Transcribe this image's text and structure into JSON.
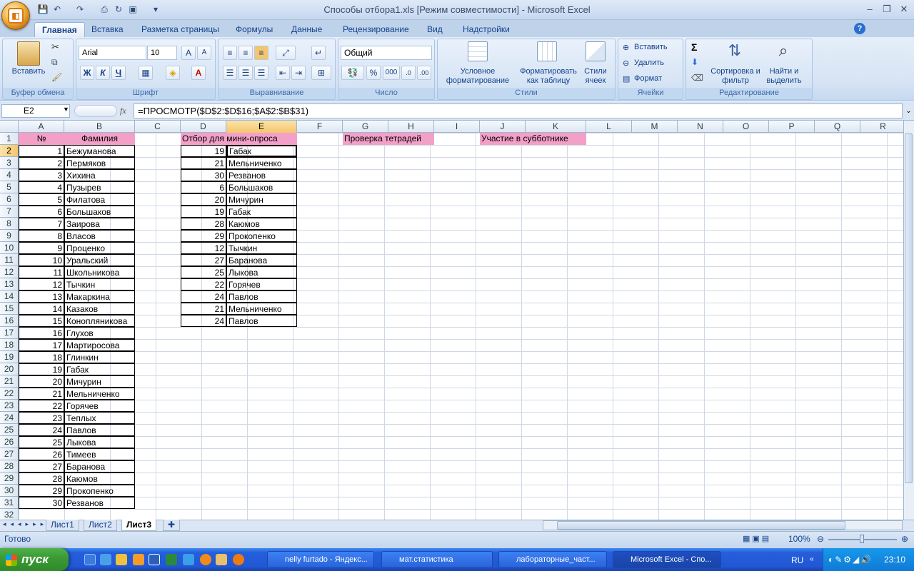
{
  "window": {
    "title": "Способы отбора1.xls  [Режим совместимости] - Microsoft Excel",
    "minimize": "–",
    "restore": "❐",
    "close": "✕"
  },
  "ribbon": {
    "tabs": [
      "Главная",
      "Вставка",
      "Разметка страницы",
      "Формулы",
      "Данные",
      "Рецензирование",
      "Вид",
      "Надстройки"
    ],
    "groups": {
      "clipboard": {
        "label": "Буфер обмена",
        "paste": "Вставить"
      },
      "font": {
        "label": "Шрифт",
        "font_name": "Arial",
        "font_size": "10",
        "bold": "Ж",
        "italic": "К",
        "underline": "Ч"
      },
      "alignment": {
        "label": "Выравнивание"
      },
      "number": {
        "label": "Число",
        "format": "Общий",
        "percent": "%",
        "thousands": "000"
      },
      "styles": {
        "label": "Стили",
        "conditional": "Условное форматирование",
        "as_table": "Форматировать как таблицу",
        "cell_styles": "Стили ячеек"
      },
      "cells": {
        "label": "Ячейки",
        "insert": "Вставить",
        "delete": "Удалить",
        "format": "Формат"
      },
      "editing": {
        "label": "Редактирование",
        "sort": "Сортировка и фильтр",
        "find": "Найти и выделить",
        "sigma": "Σ"
      }
    }
  },
  "formula_bar": {
    "name_box": "E2",
    "fx": "fx",
    "formula": "=ПРОСМОТР($D$2:$D$16;$A$2:$B$31)"
  },
  "grid": {
    "columns": [
      "A",
      "B",
      "C",
      "D",
      "E",
      "F",
      "G",
      "H",
      "I",
      "J",
      "K",
      "L",
      "M",
      "N",
      "O",
      "P",
      "Q",
      "R"
    ],
    "selected_column": "E",
    "selected_row": 2,
    "row_count": 32,
    "headers": {
      "A1": "№",
      "B1": "Фамилия",
      "D1": "Отбор для мини-опроса",
      "G1": "Проверка тетрадей",
      "J1": "Участие в субботнике"
    },
    "students": [
      [
        1,
        "Бежуманова"
      ],
      [
        2,
        "Пермяков"
      ],
      [
        3,
        "Хихина"
      ],
      [
        4,
        "Пузырев"
      ],
      [
        5,
        "Филатова"
      ],
      [
        6,
        "Большаков"
      ],
      [
        7,
        "Заирова"
      ],
      [
        8,
        "Власов"
      ],
      [
        9,
        "Проценко"
      ],
      [
        10,
        "Уральский"
      ],
      [
        11,
        "Школьникова"
      ],
      [
        12,
        "Тычкин"
      ],
      [
        13,
        "Макаркина"
      ],
      [
        14,
        "Казаков"
      ],
      [
        15,
        "Конопляникова"
      ],
      [
        16,
        "Глухов"
      ],
      [
        17,
        "Мартиросова"
      ],
      [
        18,
        "Глинкин"
      ],
      [
        19,
        "Габак"
      ],
      [
        20,
        "Мичурин"
      ],
      [
        21,
        "Мельниченко"
      ],
      [
        22,
        "Горячев"
      ],
      [
        23,
        "Теплых"
      ],
      [
        24,
        "Павлов"
      ],
      [
        25,
        "Лыкова"
      ],
      [
        26,
        "Тимеев"
      ],
      [
        27,
        "Баранова"
      ],
      [
        28,
        "Каюмов"
      ],
      [
        29,
        "Прокопенко"
      ],
      [
        30,
        "Резванов"
      ]
    ],
    "selection": [
      [
        19,
        "Габак"
      ],
      [
        21,
        "Мельниченко"
      ],
      [
        30,
        "Резванов"
      ],
      [
        6,
        "Большаков"
      ],
      [
        20,
        "Мичурин"
      ],
      [
        19,
        "Габак"
      ],
      [
        28,
        "Каюмов"
      ],
      [
        29,
        "Прокопенко"
      ],
      [
        12,
        "Тычкин"
      ],
      [
        27,
        "Баранова"
      ],
      [
        25,
        "Лыкова"
      ],
      [
        22,
        "Горячев"
      ],
      [
        24,
        "Павлов"
      ],
      [
        21,
        "Мельниченко"
      ],
      [
        24,
        "Павлов"
      ]
    ]
  },
  "sheets": [
    "Лист1",
    "Лист2",
    "Лист3"
  ],
  "active_sheet": "Лист3",
  "status": {
    "ready": "Готово",
    "zoom": "100%"
  },
  "taskbar": {
    "start": "пуск",
    "windows": [
      "nelly furtado - Яндекс...",
      "мат.статистика",
      "лабораторные_част...",
      "Microsoft Excel - Спо..."
    ],
    "active_window": 3,
    "lang": "RU",
    "clock": "23:10"
  },
  "colors": {
    "header_pink": "#f3a0c8",
    "selected_header": "#f5c56c",
    "ribbon_text": "#15428b"
  }
}
